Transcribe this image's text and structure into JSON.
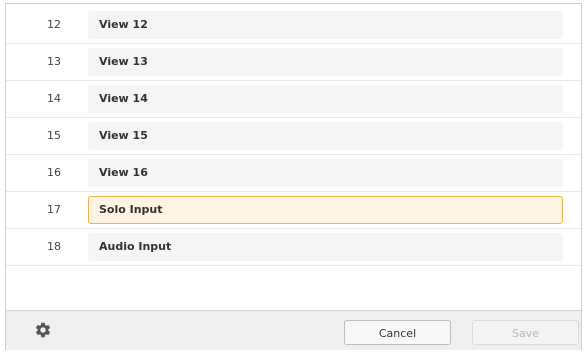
{
  "rows": [
    {
      "number": "12",
      "label": "View 12",
      "selected": false
    },
    {
      "number": "13",
      "label": "View 13",
      "selected": false
    },
    {
      "number": "14",
      "label": "View 14",
      "selected": false
    },
    {
      "number": "15",
      "label": "View 15",
      "selected": false
    },
    {
      "number": "16",
      "label": "View 16",
      "selected": false
    },
    {
      "number": "17",
      "label": "Solo Input",
      "selected": true
    },
    {
      "number": "18",
      "label": "Audio Input",
      "selected": false
    }
  ],
  "footer": {
    "settings_icon": "gear-icon",
    "cancel_label": "Cancel",
    "save_label": "Save",
    "save_enabled": false
  },
  "colors": {
    "selected_border": "#f0b04a",
    "selected_fill": "#fff3e3",
    "field_fill": "#f5f5f5",
    "footer_bg": "#efefef"
  }
}
